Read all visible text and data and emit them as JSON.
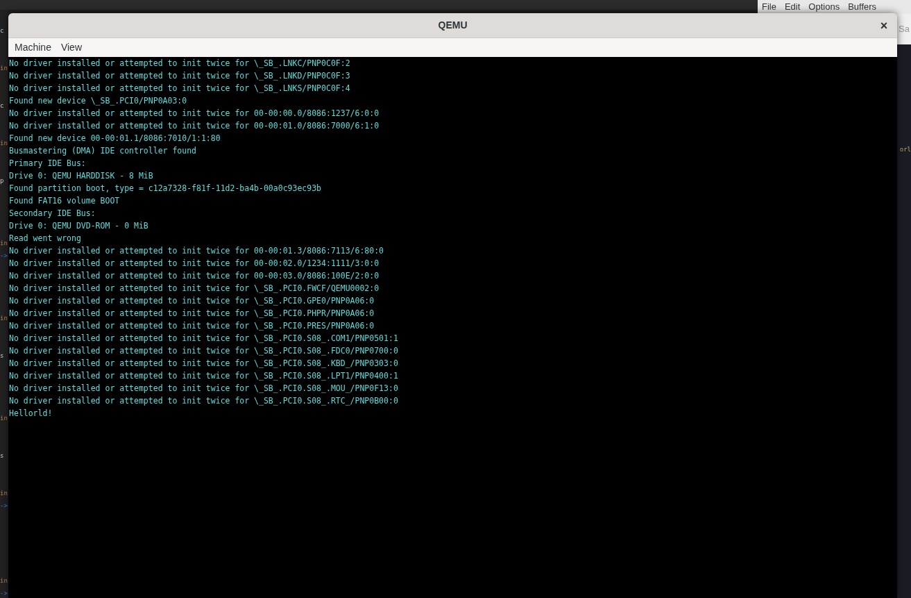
{
  "background_left_editor": {
    "lines": [
      {
        "kind": "text",
        "text": "c"
      },
      {
        "kind": "blank"
      },
      {
        "kind": "blank"
      },
      {
        "kind": "text",
        "text": "in"
      },
      {
        "kind": "blank"
      },
      {
        "kind": "blank"
      },
      {
        "kind": "text",
        "text": "c"
      },
      {
        "kind": "blank"
      },
      {
        "kind": "blank"
      },
      {
        "kind": "text",
        "text": "in"
      },
      {
        "kind": "blank"
      },
      {
        "kind": "blank"
      },
      {
        "kind": "text",
        "text": "p"
      },
      {
        "kind": "blank"
      },
      {
        "kind": "blank"
      },
      {
        "kind": "blank"
      },
      {
        "kind": "blank"
      },
      {
        "kind": "text",
        "text": "in"
      },
      {
        "kind": "text",
        "text": "->"
      },
      {
        "kind": "blank"
      },
      {
        "kind": "blank"
      },
      {
        "kind": "blank"
      },
      {
        "kind": "blank"
      },
      {
        "kind": "text",
        "text": "in"
      },
      {
        "kind": "blank"
      },
      {
        "kind": "blank"
      },
      {
        "kind": "text",
        "text": "s"
      },
      {
        "kind": "blank"
      },
      {
        "kind": "blank"
      },
      {
        "kind": "blank"
      },
      {
        "kind": "blank"
      },
      {
        "kind": "text",
        "text": "in"
      },
      {
        "kind": "blank"
      },
      {
        "kind": "blank"
      },
      {
        "kind": "text",
        "text": "s"
      },
      {
        "kind": "blank"
      },
      {
        "kind": "blank"
      },
      {
        "kind": "text",
        "text": "in"
      },
      {
        "kind": "text",
        "text": "->"
      },
      {
        "kind": "blank"
      },
      {
        "kind": "blank"
      },
      {
        "kind": "blank"
      },
      {
        "kind": "blank"
      },
      {
        "kind": "blank"
      },
      {
        "kind": "text",
        "text": "in"
      },
      {
        "kind": "text",
        "text": "->"
      }
    ]
  },
  "background_right_editor": {
    "menu": [
      "File",
      "Edit",
      "Options",
      "Buffers"
    ],
    "toolbar_text": "Sa",
    "code_fragment": "orl"
  },
  "window": {
    "title": "QEMU",
    "close": "×"
  },
  "menu": [
    "Machine",
    "View"
  ],
  "console_lines": [
    "No driver installed or attempted to init twice for \\_SB_.LNKC/PNP0C0F:2",
    "No driver installed or attempted to init twice for \\_SB_.LNKD/PNP0C0F:3",
    "No driver installed or attempted to init twice for \\_SB_.LNKS/PNP0C0F:4",
    "Found new device \\_SB_.PCI0/PNP0A03:0",
    "No driver installed or attempted to init twice for 00-00:00.0/8086:1237/6:0:0",
    "No driver installed or attempted to init twice for 00-00:01.0/8086:7000/6:1:0",
    "Found new device 00-00:01.1/8086:7010/1:1:80",
    "Busmastering (DMA) IDE controller found",
    "Primary IDE Bus:",
    "Drive 0: QEMU HARDDISK - 8 MiB",
    "Found partition boot, type = c12a7328-f81f-11d2-ba4b-00a0c93ec93b",
    "Found FAT16 volume BOOT",
    "Secondary IDE Bus:",
    "Drive 0: QEMU DVD-ROM - 0 MiB",
    "Read went wrong",
    "No driver installed or attempted to init twice for 00-00:01.3/8086:7113/6:80:0",
    "No driver installed or attempted to init twice for 00-00:02.0/1234:1111/3:0:0",
    "No driver installed or attempted to init twice for 00-00:03.0/8086:100E/2:0:0",
    "No driver installed or attempted to init twice for \\_SB_.PCI0.FWCF/QEMU0002:0",
    "No driver installed or attempted to init twice for \\_SB_.PCI0.GPE0/PNP0A06:0",
    "No driver installed or attempted to init twice for \\_SB_.PCI0.PHPR/PNP0A06:0",
    "No driver installed or attempted to init twice for \\_SB_.PCI0.PRES/PNP0A06:0",
    "No driver installed or attempted to init twice for \\_SB_.PCI0.S08_.COM1/PNP0501:1",
    "No driver installed or attempted to init twice for \\_SB_.PCI0.S08_.FDC0/PNP0700:0",
    "No driver installed or attempted to init twice for \\_SB_.PCI0.S08_.KBD_/PNP0303:0",
    "No driver installed or attempted to init twice for \\_SB_.PCI0.S08_.LPT1/PNP0400:1",
    "No driver installed or attempted to init twice for \\_SB_.PCI0.S08_.MOU_/PNP0F13:0",
    "No driver installed or attempted to init twice for \\_SB_.PCI0.S08_.RTC_/PNP0B00:0",
    "Hellorld!"
  ]
}
